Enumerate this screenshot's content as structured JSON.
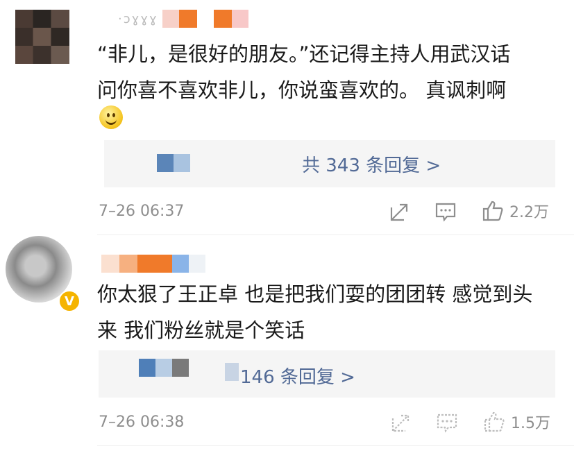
{
  "comments": [
    {
      "username_visible": "·ɔɣɣɣ",
      "text_line1": "“非儿，是很好的朋友。”还记得主持人用武汉话",
      "text_line2": "问你喜不喜欢非儿，你说蛮喜欢的。 真讽刺啊",
      "has_emoji": true,
      "emoji_icon": "smile-emoji-icon",
      "reply_count_label": "共 343 条回复 >",
      "time": "7–26 06:37",
      "like_count": "2.2万"
    },
    {
      "username_visible": "",
      "verified": true,
      "text_line1": "你太狠了王正卓 也是把我们耍的团团转 感觉到头",
      "text_line2": "来 我们粉丝就是个笑话",
      "reply_count_label": "146 条回复 >",
      "time": "7–26 06:38",
      "like_count": "1.5万"
    }
  ],
  "icons": {
    "share": "share-icon",
    "comment": "comment-icon",
    "like": "thumbs-up-icon"
  },
  "colors": {
    "link": "#526a96",
    "meta": "#8e8e8e",
    "reply_bg": "#f5f5f5",
    "badge": "#f5b400"
  }
}
